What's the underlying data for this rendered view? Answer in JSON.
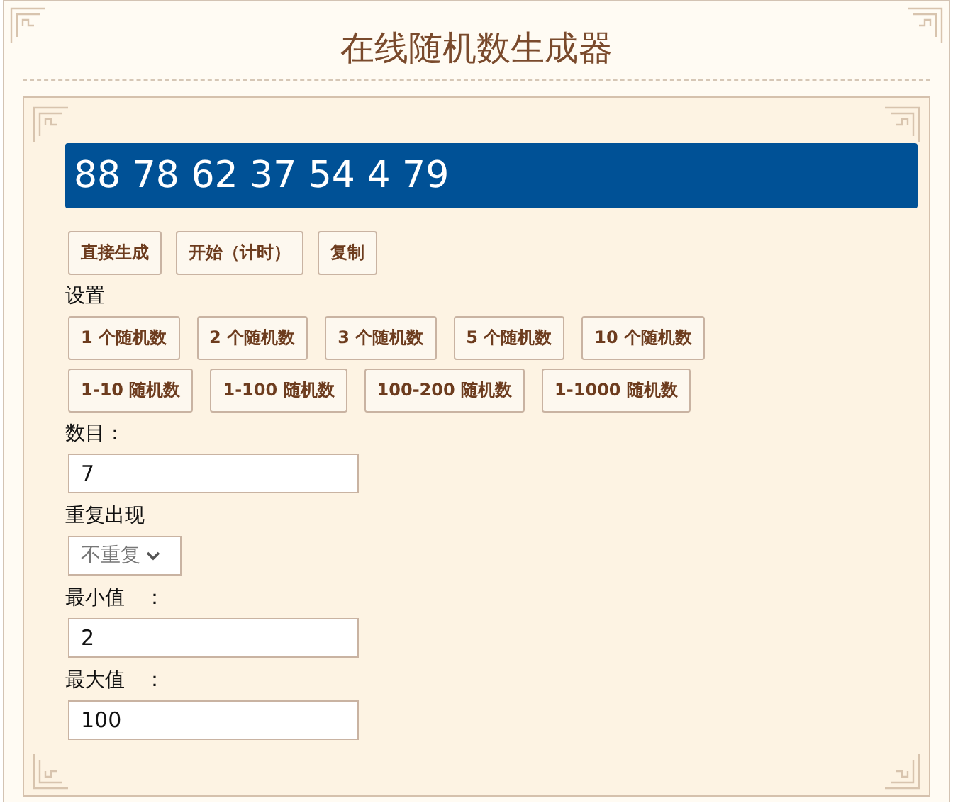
{
  "title": "在线随机数生成器",
  "result": "88 78 62 37 54 4 79",
  "actions": [
    "直接生成",
    "开始（计时）",
    "复制"
  ],
  "settings_label": "设置",
  "preset_rows": [
    [
      "1 个随机数",
      "2 个随机数",
      "3 个随机数",
      "5 个随机数",
      "10 个随机数"
    ],
    [
      "1-10 随机数",
      "1-100 随机数",
      "100-200 随机数",
      "1-1000 随机数"
    ]
  ],
  "fields": [
    {
      "kind": "input",
      "label": "数目：",
      "value": "7"
    },
    {
      "kind": "select",
      "label": "重复出现",
      "value": "不重复"
    },
    {
      "kind": "input",
      "label": "最小值　：",
      "value": "2"
    },
    {
      "kind": "input",
      "label": "最大值　：",
      "value": "100"
    }
  ]
}
